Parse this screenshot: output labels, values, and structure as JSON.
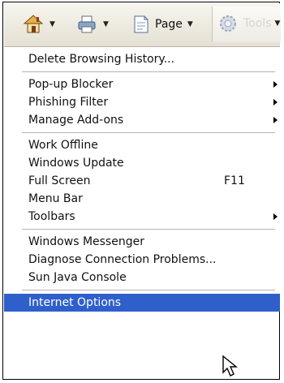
{
  "toolbar": {
    "home": {
      "icon": "home-icon"
    },
    "print": {
      "icon": "print-icon"
    },
    "page": {
      "label": "Page",
      "icon": "page-icon"
    },
    "tools": {
      "label": "Tools",
      "icon": "gear-icon"
    }
  },
  "menu": {
    "delete_history": "Delete Browsing History...",
    "popup_blocker": "Pop-up Blocker",
    "phishing_filter": "Phishing Filter",
    "manage_addons": "Manage Add-ons",
    "work_offline": "Work Offline",
    "windows_update": "Windows Update",
    "full_screen": "Full Screen",
    "full_screen_shortcut": "F11",
    "menu_bar": "Menu Bar",
    "toolbars": "Toolbars",
    "windows_messenger": "Windows Messenger",
    "diagnose": "Diagnose Connection Problems...",
    "sun_java": "Sun Java Console",
    "internet_options": "Internet Options"
  },
  "colors": {
    "highlight": "#2f5fcb",
    "text": "#111111"
  }
}
